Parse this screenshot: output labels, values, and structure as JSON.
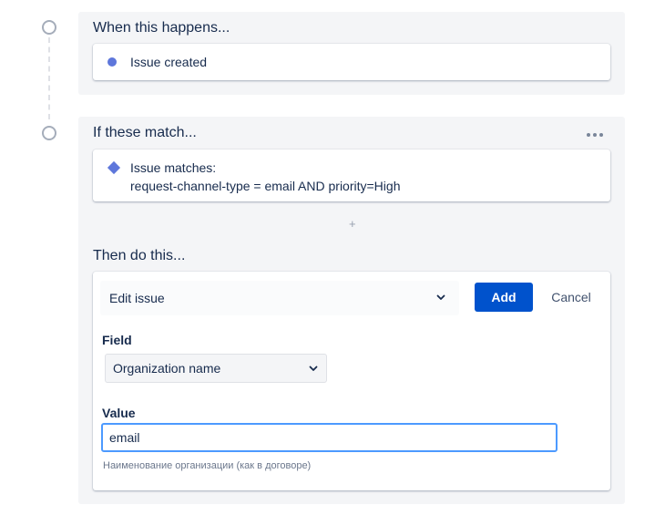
{
  "trigger": {
    "heading": "When this happens...",
    "item_label": "Issue created"
  },
  "condition": {
    "heading": "If these match...",
    "item_title": "Issue matches:",
    "item_query": "request-channel-type = email AND priority=High",
    "add_symbol": "+"
  },
  "action": {
    "heading": "Then do this...",
    "action_select_value": "Edit issue",
    "add_button": "Add",
    "cancel_button": "Cancel",
    "field_label": "Field",
    "field_select_value": "Organization name",
    "value_label": "Value",
    "value_input": "email",
    "value_hint": "Наименование организации (как в договоре)"
  },
  "icons": {
    "trigger_item": "dot-icon",
    "condition_item": "diamond-icon",
    "menu": "more-horizontal-icon",
    "dropdown": "chevron-down-icon"
  },
  "colors": {
    "primary_button": "#0052CC",
    "focus_border": "#4C9AFF",
    "item_icon": "#5E77DB",
    "panel_bg": "#F4F5F7"
  }
}
